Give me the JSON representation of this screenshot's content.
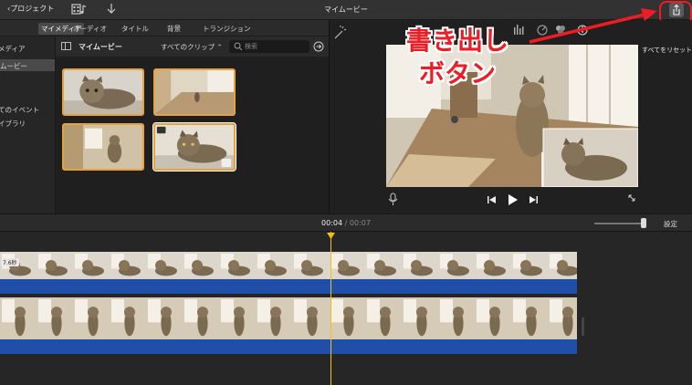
{
  "titlebar": {
    "back_label": "プロジェクト",
    "window_title": "マイムービー"
  },
  "tabs": [
    {
      "label": "マイメディア",
      "active": true
    },
    {
      "label": "オーディオ",
      "active": false
    },
    {
      "label": "タイトル",
      "active": false
    },
    {
      "label": "背景",
      "active": false
    },
    {
      "label": "トランジション",
      "active": false
    }
  ],
  "sidebar": {
    "items": [
      {
        "label": "メディア"
      },
      {
        "label": "ムービー",
        "selected": true
      },
      {
        "label": "てのイベント"
      },
      {
        "label": "イブラリ"
      }
    ]
  },
  "browser": {
    "title": "マイムービー",
    "filter_label": "すべてのクリップ ⌃",
    "search_placeholder": "検索"
  },
  "viewer": {
    "reset_label": "すべてをリセット"
  },
  "annotation": {
    "line1": "書き出し",
    "line2": "ボタン",
    "color": "#ee1c24"
  },
  "timeline": {
    "current_time": "00:04",
    "separator": "/",
    "total_time": "00:07",
    "settings_label": "設定",
    "clip_badge": "7.6秒",
    "playhead_color": "#f4c20d",
    "audio_color": "#1f4fa8"
  }
}
